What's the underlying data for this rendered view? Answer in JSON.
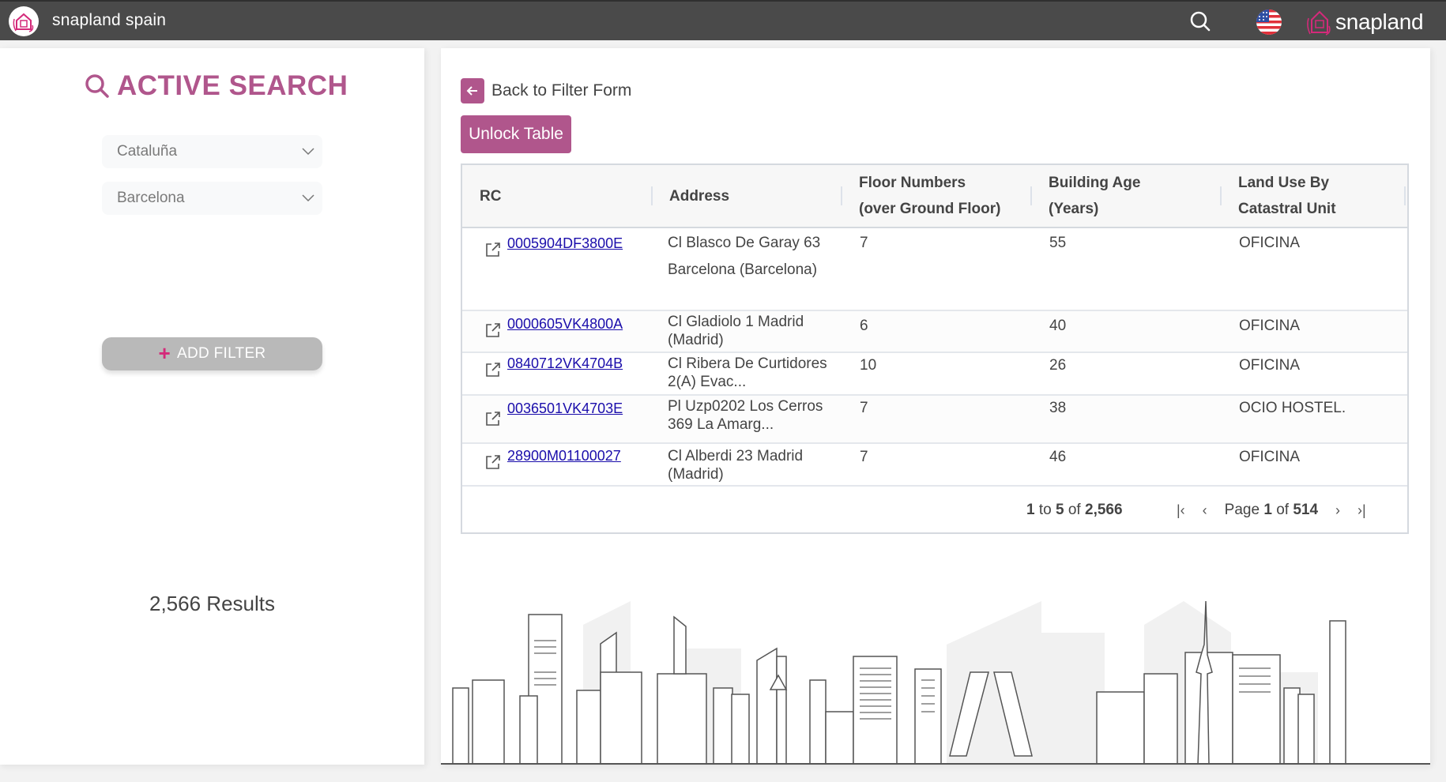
{
  "topbar": {
    "app_title": "snapland spain",
    "brand": "snapland",
    "language_flag": "us-flag-icon"
  },
  "colors": {
    "accent": "#b0568c",
    "topbar_bg": "#4a4a4a",
    "link": "#1a0dab",
    "add_filter_bg": "#b9b9b9",
    "plus": "#d42a7a"
  },
  "sidebar": {
    "title": "ACTIVE SEARCH",
    "filters": [
      {
        "label": "Cataluña"
      },
      {
        "label": "Barcelona"
      }
    ],
    "add_filter_label": "ADD FILTER",
    "results_text": "2,566 Results"
  },
  "main": {
    "back_label": "Back to Filter Form",
    "unlock_label": "Unlock Table",
    "table": {
      "columns": [
        {
          "line1": "RC",
          "line2": ""
        },
        {
          "line1": "Address",
          "line2": ""
        },
        {
          "line1": "Floor Numbers",
          "line2": "(over Ground Floor)"
        },
        {
          "line1": "Building Age",
          "line2": "(Years)"
        },
        {
          "line1": "Land Use By",
          "line2": "Catastral Unit"
        }
      ],
      "rows": [
        {
          "rc": "0005904DF3800E",
          "address": "Cl Blasco De Garay 63 Barcelona (Barcelona)",
          "floors": "7",
          "age": "55",
          "land_use": "OFICINA"
        },
        {
          "rc": "0000605VK4800A",
          "address": "Cl Gladiolo 1 Madrid (Madrid)",
          "floors": "6",
          "age": "40",
          "land_use": "OFICINA"
        },
        {
          "rc": "0840712VK4704B",
          "address": "Cl Ribera De Curtidores 2(A) Evac...",
          "floors": "10",
          "age": "26",
          "land_use": "OFICINA"
        },
        {
          "rc": "0036501VK4703E",
          "address": "Pl Uzp0202 Los Cerros 369 La Amarg...",
          "floors": "7",
          "age": "38",
          "land_use": "OCIO HOSTEL."
        },
        {
          "rc": "28900M01100027",
          "address": "Cl Alberdi 23 Madrid (Madrid)",
          "floors": "7",
          "age": "46",
          "land_use": "OFICINA"
        }
      ]
    },
    "pagination": {
      "from": "1",
      "to_word": "to",
      "to": "5",
      "of_word": "of",
      "total": "2,566",
      "page_word": "Page",
      "page": "1",
      "pages": "514"
    }
  }
}
